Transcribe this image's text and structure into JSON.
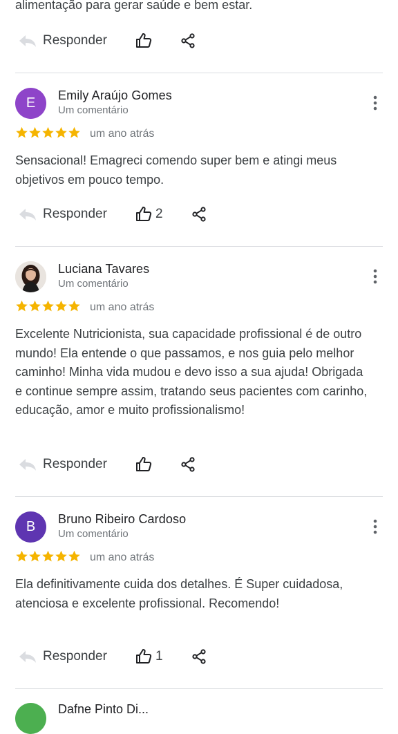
{
  "top_snippet": "alimentação para gerar saúde e bem estar.",
  "actions": {
    "reply_label": "Responder"
  },
  "reviews": [
    {
      "initial": "E",
      "avatar_color": "#8e44c9",
      "name": "Emily Araújo Gomes",
      "meta": "Um comentário",
      "rating": 5,
      "date": "um ano atrás",
      "text": "Sensacional! Emagreci comendo super bem e atingi meus objetivos em pouco tempo.",
      "likes": "2"
    },
    {
      "initial": "",
      "avatar_color": "#3a2a24",
      "name": "Luciana Tavares",
      "meta": "Um comentário",
      "rating": 5,
      "date": "um ano atrás",
      "text": "Excelente Nutricionista, sua capacidade profissional é de outro mundo! Ela entende o que passamos, e nos guia pelo melhor caminho! Minha vida mudou e devo isso a sua ajuda! Obrigada e continue sempre assim, tratando seus pacientes com carinho, educação, amor e muito profissionalismo!",
      "likes": ""
    },
    {
      "initial": "B",
      "avatar_color": "#5e35b1",
      "name": "Bruno Ribeiro Cardoso",
      "meta": "Um comentário",
      "rating": 5,
      "date": "um ano atrás",
      "text": "Ela definitivamente cuida dos detalhes. É Super cuidadosa, atenciosa e excelente profissional. Recomendo!",
      "likes": "1"
    }
  ],
  "next_review_name": "Dafne Pinto Di...",
  "colors": {
    "star": "#f5b400",
    "divider": "#dadce0",
    "text": "#3c4043",
    "muted": "#70757a"
  }
}
